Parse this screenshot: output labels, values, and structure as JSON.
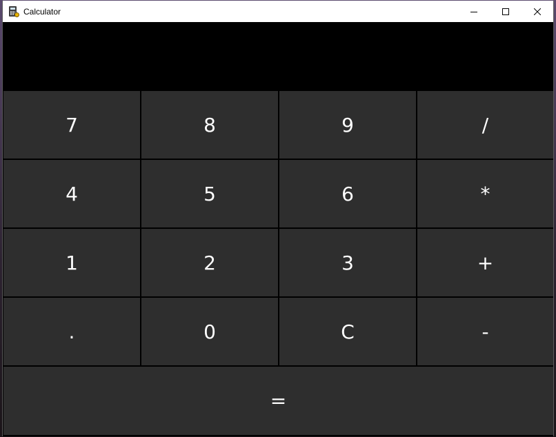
{
  "window": {
    "title": "Calculator",
    "icon": "calculator-icon",
    "controls": [
      "minimize-icon",
      "maximize-icon",
      "close-icon"
    ]
  },
  "display": {
    "value": ""
  },
  "keypad": {
    "rows": [
      [
        {
          "label": "7",
          "name": "key-7"
        },
        {
          "label": "8",
          "name": "key-8"
        },
        {
          "label": "9",
          "name": "key-9"
        },
        {
          "label": "/",
          "name": "key-divide"
        }
      ],
      [
        {
          "label": "4",
          "name": "key-4"
        },
        {
          "label": "5",
          "name": "key-5"
        },
        {
          "label": "6",
          "name": "key-6"
        },
        {
          "label": "*",
          "name": "key-multiply"
        }
      ],
      [
        {
          "label": "1",
          "name": "key-1"
        },
        {
          "label": "2",
          "name": "key-2"
        },
        {
          "label": "3",
          "name": "key-3"
        },
        {
          "label": "+",
          "name": "key-add"
        }
      ],
      [
        {
          "label": ".",
          "name": "key-decimal"
        },
        {
          "label": "0",
          "name": "key-0"
        },
        {
          "label": "C",
          "name": "key-clear"
        },
        {
          "label": "-",
          "name": "key-subtract"
        }
      ]
    ],
    "equals": {
      "label": "=",
      "name": "key-equals"
    }
  },
  "colors": {
    "key_background": "#2e2e2e",
    "display_background": "#000000",
    "text": "#ffffff"
  }
}
